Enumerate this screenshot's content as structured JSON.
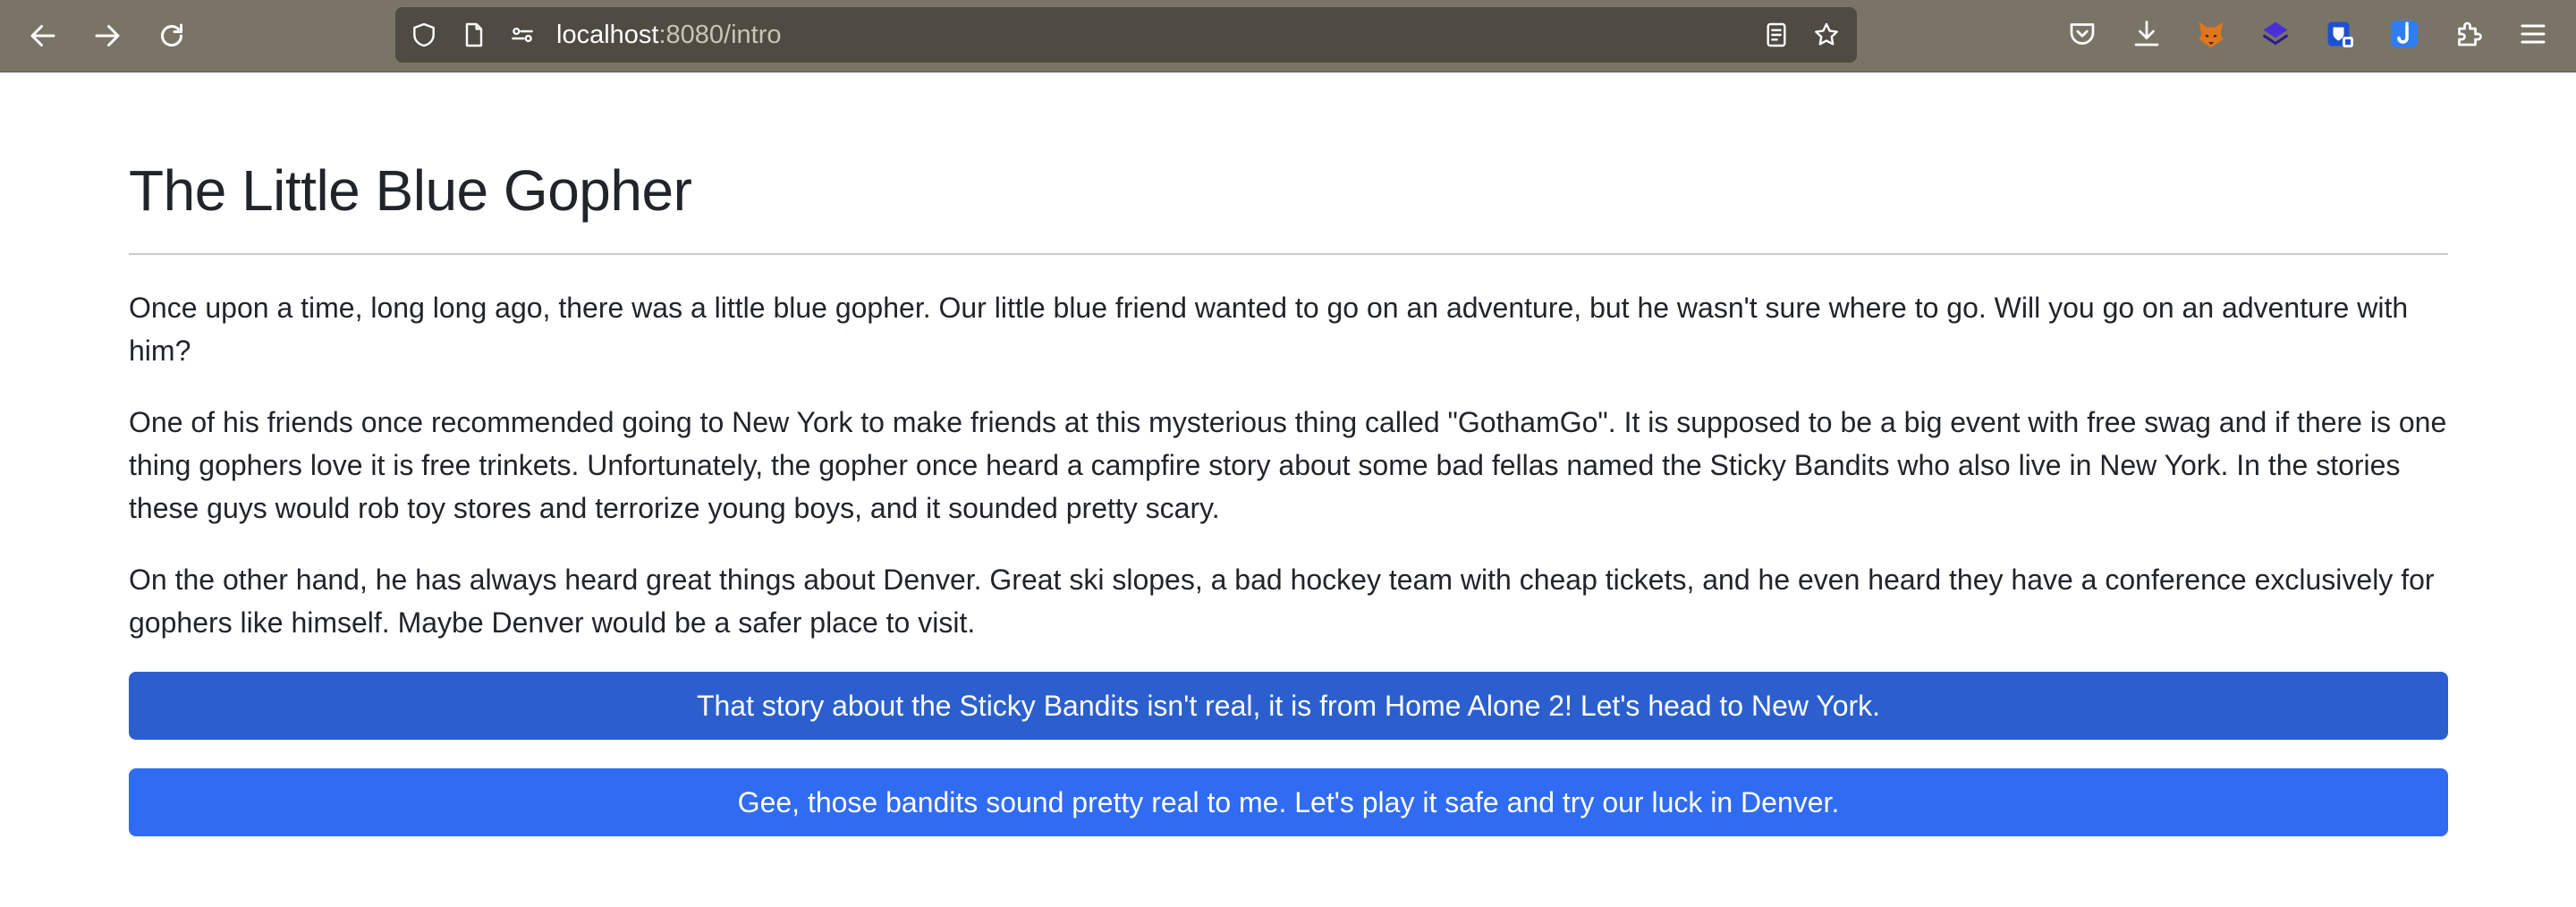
{
  "browser": {
    "url_host": "localhost",
    "url_path": ":8080/intro",
    "icons": {
      "back": "arrow-left-icon",
      "forward": "arrow-right-icon",
      "reload": "reload-icon",
      "shield": "shield-icon",
      "page": "page-icon",
      "permissions": "permissions-icon",
      "reader": "reader-view-icon",
      "bookmark": "star-icon",
      "pocket": "pocket-icon",
      "downloads": "download-icon",
      "extensions": "puzzle-icon",
      "menu": "hamburger-menu-icon"
    }
  },
  "page": {
    "title": "The Little Blue Gopher",
    "paragraphs": [
      "Once upon a time, long long ago, there was a little blue gopher. Our little blue friend wanted to go on an adventure, but he wasn't sure where to go. Will you go on an adventure with him?",
      "One of his friends once recommended going to New York to make friends at this mysterious thing called \"GothamGo\". It is supposed to be a big event with free swag and if there is one thing gophers love it is free trinkets. Unfortunately, the gopher once heard a campfire story about some bad fellas named the Sticky Bandits who also live in New York. In the stories these guys would rob toy stores and terrorize young boys, and it sounded pretty scary.",
      "On the other hand, he has always heard great things about Denver. Great ski slopes, a bad hockey team with cheap tickets, and he even heard they have a conference exclusively for gophers like himself. Maybe Denver would be a safer place to visit."
    ],
    "options": [
      "That story about the Sticky Bandits isn't real, it is from Home Alone 2! Let's head to New York.",
      "Gee, those bandits sound pretty real to me. Let's play it safe and try our luck in Denver."
    ]
  },
  "colors": {
    "toolbar": "#7a7466",
    "urlbar": "#4f4b42",
    "button_primary": "#2b5fce",
    "button_secondary": "#306cf1",
    "text": "#212529"
  }
}
